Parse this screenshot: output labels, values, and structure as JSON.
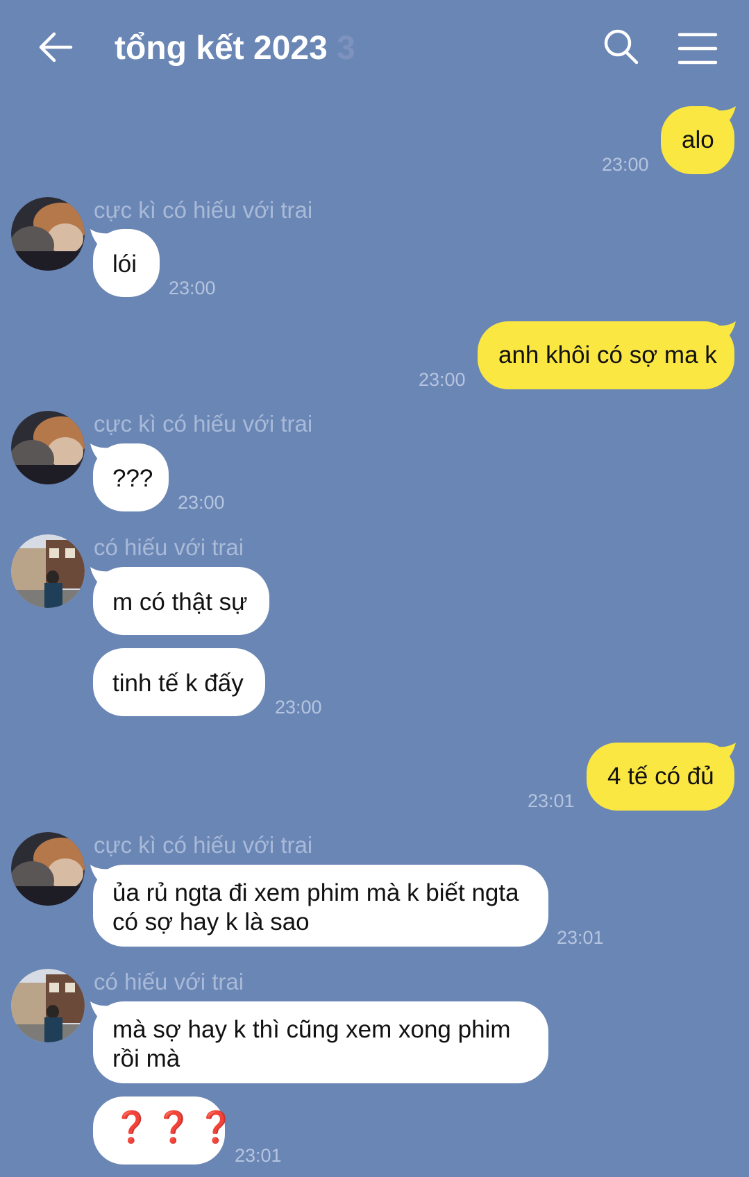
{
  "header": {
    "title": "tổng kết 2023",
    "member_count": "3"
  },
  "colors": {
    "background": "#6a86b5",
    "incoming_bubble": "#ffffff",
    "outgoing_bubble": "#fbe742"
  },
  "icons": {
    "back": "arrow-left-icon",
    "search": "search-icon",
    "menu": "hamburger-menu-icon"
  },
  "messages": [
    {
      "direction": "out",
      "text": "alo",
      "time": "23:00"
    },
    {
      "direction": "in",
      "sender": "cực kì có hiếu với trai",
      "text": "lói",
      "time": "23:00"
    },
    {
      "direction": "out",
      "text": "anh khôi có sợ ma k",
      "time": "23:00"
    },
    {
      "direction": "in",
      "sender": "cực kì có hiếu với trai",
      "text": "???",
      "time": "23:00"
    },
    {
      "direction": "in",
      "sender": "có hiếu với trai",
      "text": "m có thật sự"
    },
    {
      "direction": "in",
      "text": "tinh tế k đấy",
      "time": "23:00"
    },
    {
      "direction": "out",
      "text": "4 tế có đủ",
      "time": "23:01"
    },
    {
      "direction": "in",
      "sender": "cực kì có hiếu với trai",
      "text": "ủa rủ ngta đi xem phim mà k biết ngta có sợ hay k là sao",
      "time": "23:01"
    },
    {
      "direction": "in",
      "sender": "có hiếu với trai",
      "text": "mà sợ hay k thì cũng xem xong phim rồi mà"
    },
    {
      "direction": "in",
      "text": "❓❓❓",
      "time": "23:01"
    }
  ]
}
